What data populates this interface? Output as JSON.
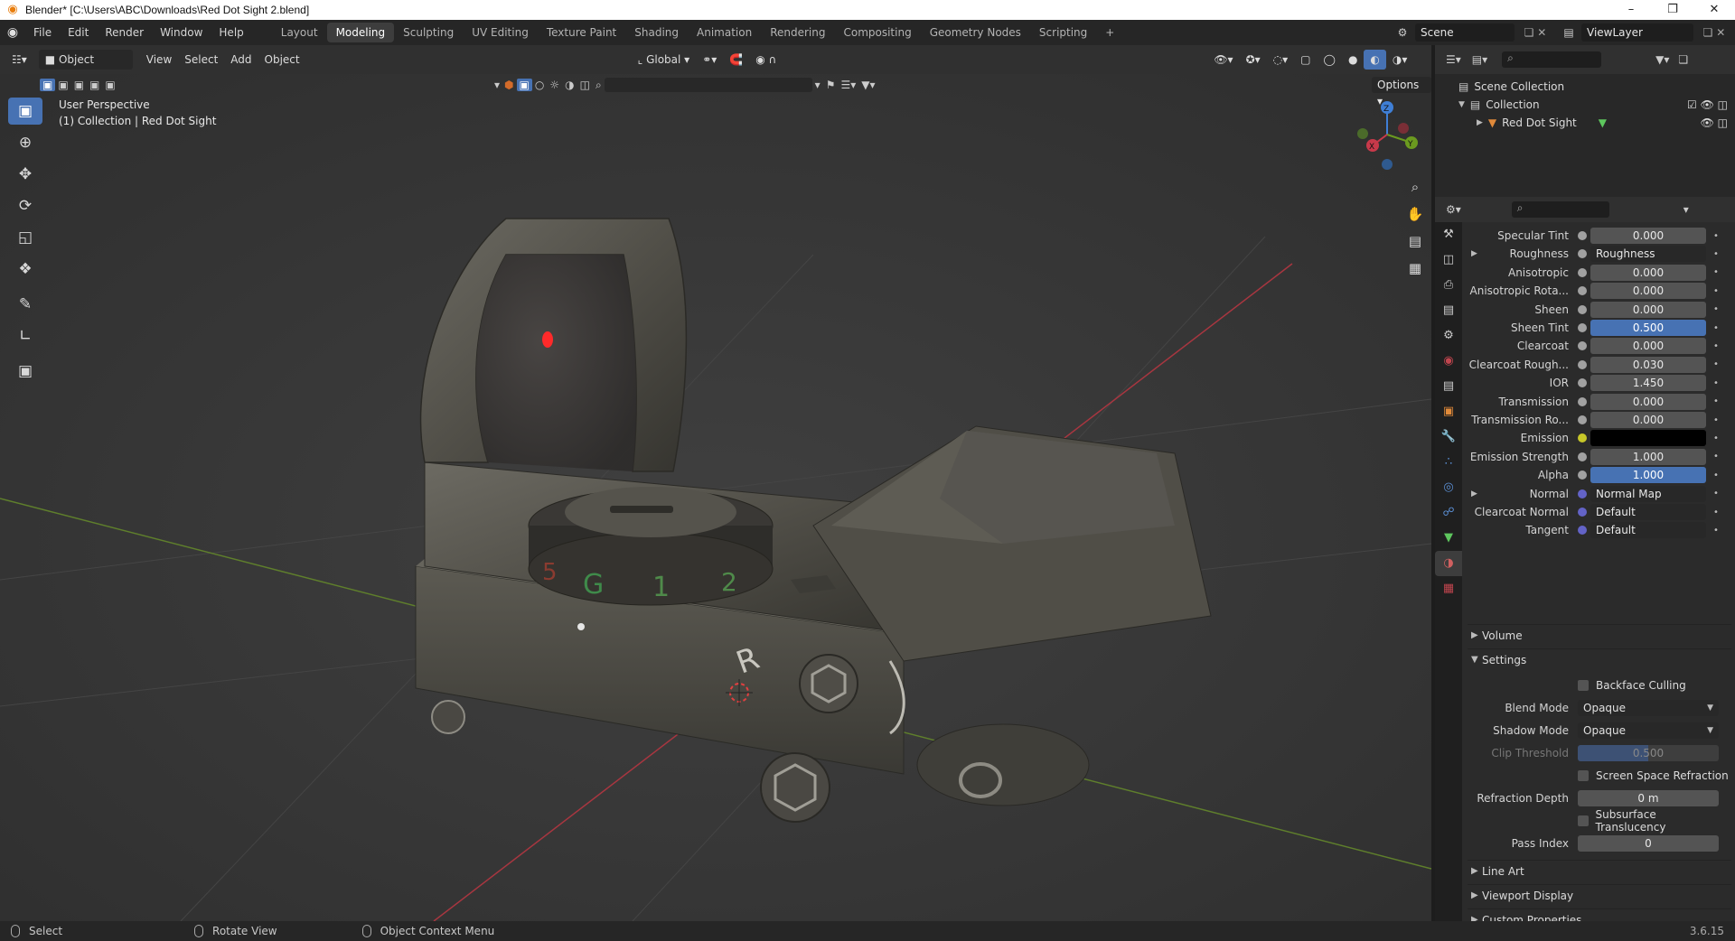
{
  "window": {
    "title": "Blender* [C:\\Users\\ABC\\Downloads\\Red Dot Sight 2.blend]",
    "minimize": "–",
    "maximize": "❐",
    "close": "✕"
  },
  "menu": [
    "File",
    "Edit",
    "Render",
    "Window",
    "Help"
  ],
  "workspaces": [
    "Layout",
    "Modeling",
    "Sculpting",
    "UV Editing",
    "Texture Paint",
    "Shading",
    "Animation",
    "Rendering",
    "Compositing",
    "Geometry Nodes",
    "Scripting",
    "+"
  ],
  "active_workspace": "Modeling",
  "scene": {
    "name": "Scene",
    "view_layer": "ViewLayer"
  },
  "viewport_header": {
    "mode": "Object Mode",
    "menus": [
      "View",
      "Select",
      "Add",
      "Object"
    ],
    "orientation": "Global",
    "options": "Options"
  },
  "viewport": {
    "perspective": "User Perspective",
    "collection_label": "(1) Collection | Red Dot Sight",
    "gizmo": {
      "x": "X",
      "y": "Y",
      "z": "Z"
    },
    "model_marks": [
      "R",
      "G",
      "1",
      "2",
      "5"
    ]
  },
  "outliner": {
    "scene_collection": "Scene Collection",
    "collection": "Collection",
    "object": "Red Dot Sight"
  },
  "properties": {
    "rows": [
      {
        "label": "Specular Tint",
        "value": "0.000",
        "type": "num",
        "sock": "#a1a1a1"
      },
      {
        "label": "Roughness",
        "value": "Roughness",
        "type": "link",
        "sock": "#a1a1a1",
        "expand": true
      },
      {
        "label": "Anisotropic",
        "value": "0.000",
        "type": "num",
        "sock": "#a1a1a1"
      },
      {
        "label": "Anisotropic Rota...",
        "value": "0.000",
        "type": "num",
        "sock": "#a1a1a1"
      },
      {
        "label": "Sheen",
        "value": "0.000",
        "type": "num",
        "sock": "#a1a1a1"
      },
      {
        "label": "Sheen Tint",
        "value": "0.500",
        "type": "blue",
        "sock": "#a1a1a1"
      },
      {
        "label": "Clearcoat",
        "value": "0.000",
        "type": "num",
        "sock": "#a1a1a1"
      },
      {
        "label": "Clearcoat Rough...",
        "value": "0.030",
        "type": "num",
        "sock": "#a1a1a1"
      },
      {
        "label": "IOR",
        "value": "1.450",
        "type": "num",
        "sock": "#a1a1a1"
      },
      {
        "label": "Transmission",
        "value": "0.000",
        "type": "num",
        "sock": "#a1a1a1"
      },
      {
        "label": "Transmission Ro...",
        "value": "0.000",
        "type": "num",
        "sock": "#a1a1a1"
      },
      {
        "label": "Emission",
        "value": "",
        "type": "black",
        "sock": "#c7c729"
      },
      {
        "label": "Emission Strength",
        "value": "1.000",
        "type": "num",
        "sock": "#a1a1a1"
      },
      {
        "label": "Alpha",
        "value": "1.000",
        "type": "blue",
        "sock": "#a1a1a1"
      },
      {
        "label": "Normal",
        "value": "Normal Map",
        "type": "link",
        "sock": "#6363c7",
        "expand": true
      },
      {
        "label": "Clearcoat Normal",
        "value": "Default",
        "type": "link",
        "sock": "#6363c7"
      },
      {
        "label": "Tangent",
        "value": "Default",
        "type": "link",
        "sock": "#6363c7"
      }
    ],
    "panels": {
      "volume": "Volume",
      "settings": "Settings",
      "line_art": "Line Art",
      "viewport_display": "Viewport Display",
      "custom_properties": "Custom Properties"
    },
    "settings": {
      "backface_culling": "Backface Culling",
      "blend_mode_label": "Blend Mode",
      "blend_mode": "Opaque",
      "shadow_mode_label": "Shadow Mode",
      "shadow_mode": "Opaque",
      "clip_threshold_label": "Clip Threshold",
      "clip_threshold": "0.500",
      "screen_space_refraction": "Screen Space Refraction",
      "refraction_depth_label": "Refraction Depth",
      "refraction_depth": "0 m",
      "subsurface_translucency": "Subsurface Translucency",
      "pass_index_label": "Pass Index",
      "pass_index": "0"
    }
  },
  "statusbar": {
    "select": "Select",
    "rotate_view": "Rotate View",
    "context_menu": "Object Context Menu",
    "version": "3.6.15"
  },
  "colors": {
    "accent": "#4772b3",
    "brand": "#e87d0d",
    "x_axis": "#c8394a",
    "y_axis": "#6b9a1f",
    "z_axis": "#3f7fd6"
  }
}
